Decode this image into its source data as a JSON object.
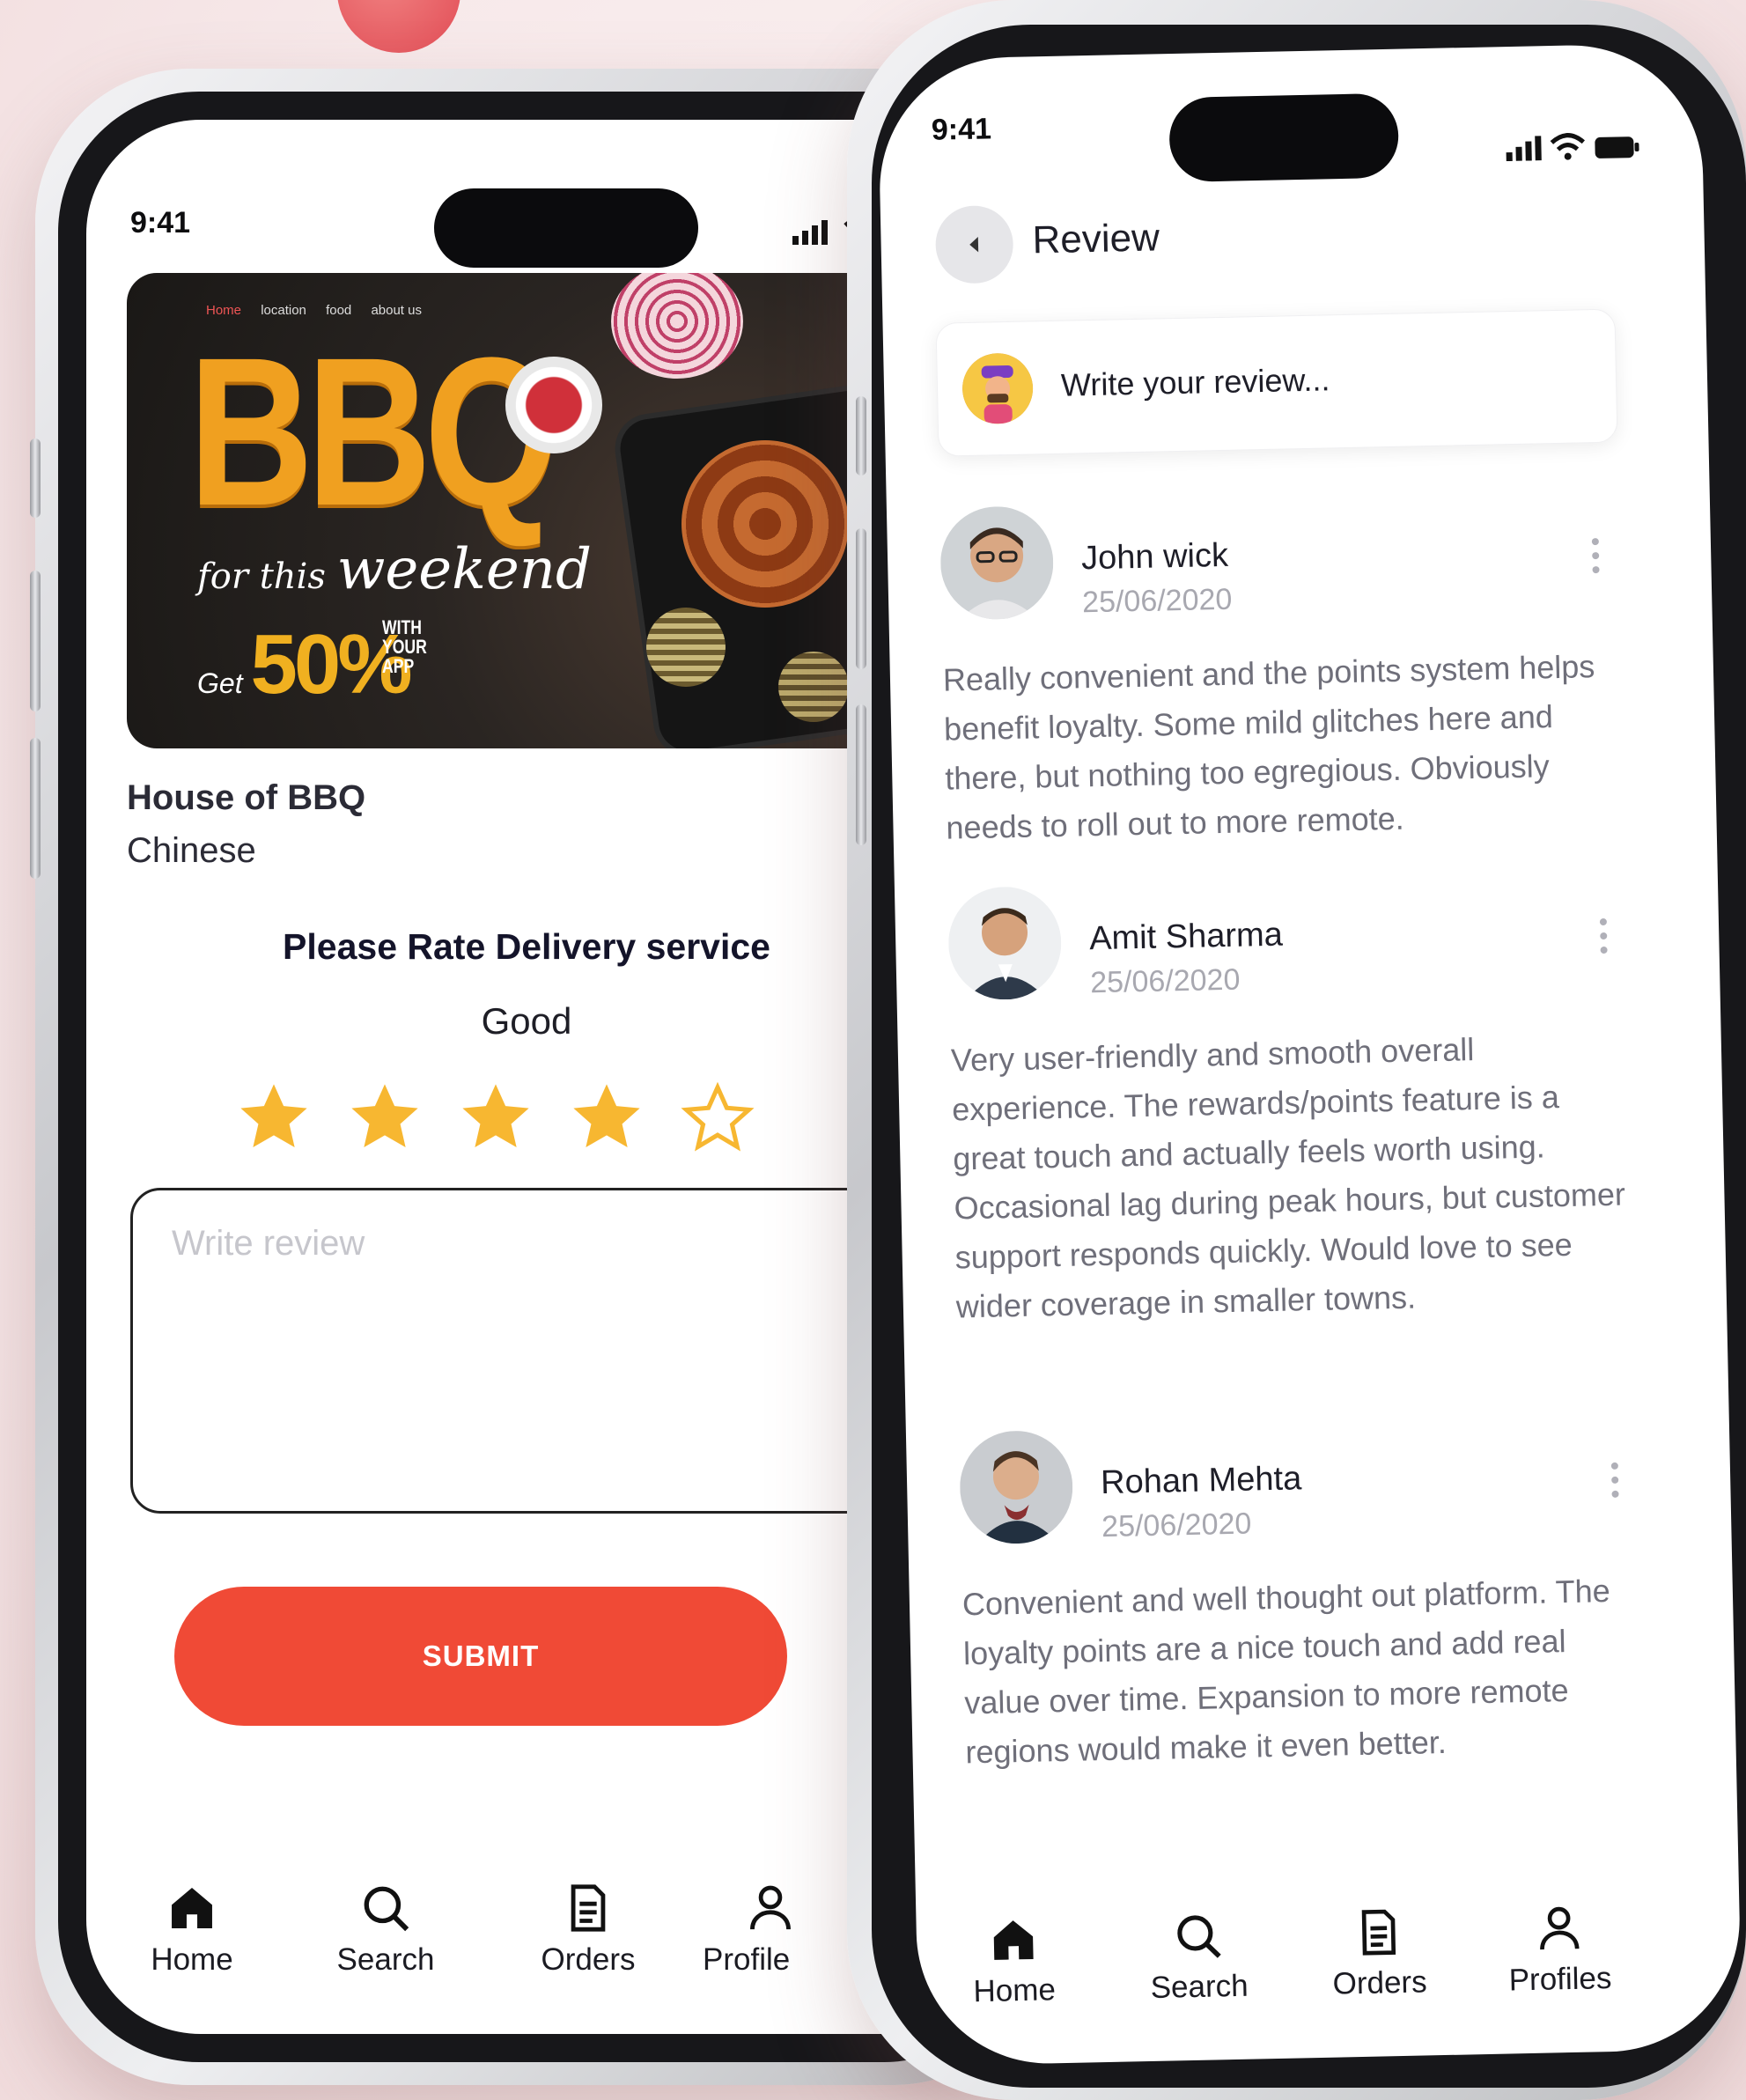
{
  "phone1": {
    "status_time": "9:41",
    "banner": {
      "nav": [
        "Home",
        "location",
        "food",
        "about us"
      ],
      "headline": "BBQ",
      "subline_small": "for this",
      "subline_big": "weekend",
      "offer_prefix": "Get",
      "offer_value": "50%",
      "offer_suffix_1": "WITH",
      "offer_suffix_2": "YOUR",
      "offer_suffix_3": "APP"
    },
    "restaurant_name": "House of BBQ",
    "cuisine": "Chinese",
    "rate_title": "Please Rate Delivery service",
    "rating_label": "Good",
    "rating": 4,
    "rating_max": 5,
    "review_placeholder": "Write review",
    "submit_label": "SUBMIT",
    "tabs": [
      {
        "label": "Home",
        "icon": "home-icon"
      },
      {
        "label": "Search",
        "icon": "search-icon"
      },
      {
        "label": "Orders",
        "icon": "orders-icon"
      },
      {
        "label": "Profile",
        "icon": "profile-icon"
      }
    ]
  },
  "phone2": {
    "status_time": "9:41",
    "title": "Review",
    "write_placeholder": "Write your review...",
    "reviews": [
      {
        "name": "John wick",
        "date": "25/06/2020",
        "text": "Really convenient and the points system helps benefit loyalty. Some mild glitches here and there, but nothing too egregious. Obviously needs to roll out to more remote."
      },
      {
        "name": "Amit Sharma",
        "date": "25/06/2020",
        "text": "Very user-friendly and smooth overall experience. The rewards/points feature is a great touch and actually feels worth using. Occasional lag during peak hours, but customer support responds quickly. Would love to see wider coverage in smaller towns."
      },
      {
        "name": "Rohan Mehta",
        "date": "25/06/2020",
        "text": "Convenient and well thought out platform. The loyalty points are a nice touch and add real value over time. Expansion to more remote regions would make it even better."
      }
    ],
    "tabs": [
      {
        "label": "Home",
        "icon": "home-icon"
      },
      {
        "label": "Search",
        "icon": "search-icon"
      },
      {
        "label": "Orders",
        "icon": "orders-icon"
      },
      {
        "label": "Profiles",
        "icon": "profile-icon"
      }
    ]
  },
  "colors": {
    "accent": "#f04a36",
    "star": "#f7b731",
    "background": "#f7e9ea"
  }
}
